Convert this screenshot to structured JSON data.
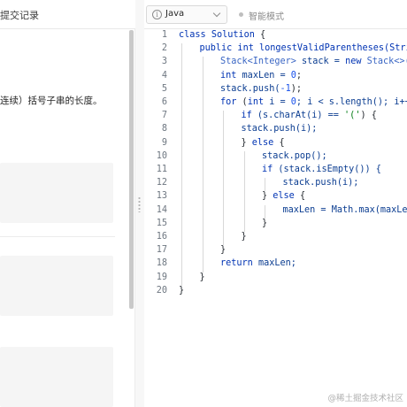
{
  "left_panel": {
    "tab_label": "提交记录",
    "description_fragment": "连续）括号子串的长度。"
  },
  "editor": {
    "language": "Java",
    "mode_label": "智能模式",
    "code_lines": [
      {
        "n": "1",
        "indent": 0,
        "tokens": [
          {
            "t": "class ",
            "c": "kw"
          },
          {
            "t": "Solution",
            "c": "cls"
          },
          {
            "t": " {",
            "c": "pl"
          }
        ]
      },
      {
        "n": "2",
        "indent": 1,
        "tokens": [
          {
            "t": "public int ",
            "c": "kw"
          },
          {
            "t": "longestValidParentheses(String s) {",
            "c": "cls"
          }
        ]
      },
      {
        "n": "3",
        "indent": 2,
        "tokens": [
          {
            "t": "Stack<Integer>",
            "c": "typ"
          },
          {
            "t": " stack = ",
            "c": "id"
          },
          {
            "t": "new ",
            "c": "kw"
          },
          {
            "t": "Stack<>();",
            "c": "typ"
          }
        ]
      },
      {
        "n": "4",
        "indent": 2,
        "tokens": [
          {
            "t": "int ",
            "c": "kw"
          },
          {
            "t": "maxLen = ",
            "c": "id"
          },
          {
            "t": "0",
            "c": "num"
          },
          {
            "t": ";",
            "c": "pl"
          }
        ]
      },
      {
        "n": "5",
        "indent": 2,
        "tokens": [
          {
            "t": "stack.push(",
            "c": "id"
          },
          {
            "t": "-1",
            "c": "num"
          },
          {
            "t": ");",
            "c": "pl"
          }
        ]
      },
      {
        "n": "6",
        "indent": 2,
        "tokens": [
          {
            "t": "for ",
            "c": "kw"
          },
          {
            "t": "(",
            "c": "pl"
          },
          {
            "t": "int ",
            "c": "kw"
          },
          {
            "t": "i = ",
            "c": "id"
          },
          {
            "t": "0",
            "c": "num"
          },
          {
            "t": "; i < s.length(); i++) {",
            "c": "id"
          }
        ]
      },
      {
        "n": "7",
        "indent": 3,
        "tokens": [
          {
            "t": "if ",
            "c": "kw"
          },
          {
            "t": "(s.charAt(i) == ",
            "c": "id"
          },
          {
            "t": "'('",
            "c": "str"
          },
          {
            "t": ") {",
            "c": "pl"
          }
        ]
      },
      {
        "n": "8",
        "indent": 3,
        "tokens": [
          {
            "t": "stack.push(i);",
            "c": "id"
          }
        ]
      },
      {
        "n": "9",
        "indent": 3,
        "tokens": [
          {
            "t": "} ",
            "c": "pl"
          },
          {
            "t": "else ",
            "c": "kw"
          },
          {
            "t": "{",
            "c": "pl"
          }
        ]
      },
      {
        "n": "10",
        "indent": 4,
        "tokens": [
          {
            "t": "stack.pop();",
            "c": "id"
          }
        ]
      },
      {
        "n": "11",
        "indent": 4,
        "tokens": [
          {
            "t": "if ",
            "c": "kw"
          },
          {
            "t": "(stack.isEmpty()) {",
            "c": "id"
          }
        ]
      },
      {
        "n": "12",
        "indent": 5,
        "tokens": [
          {
            "t": "stack.push(i);",
            "c": "id"
          }
        ]
      },
      {
        "n": "13",
        "indent": 4,
        "tokens": [
          {
            "t": "} ",
            "c": "pl"
          },
          {
            "t": "else ",
            "c": "kw"
          },
          {
            "t": "{",
            "c": "pl"
          }
        ]
      },
      {
        "n": "14",
        "indent": 5,
        "tokens": [
          {
            "t": "maxLen = Math.max(maxLen, i - stack.peek());",
            "c": "id"
          }
        ]
      },
      {
        "n": "15",
        "indent": 4,
        "tokens": [
          {
            "t": "}",
            "c": "pl"
          }
        ]
      },
      {
        "n": "16",
        "indent": 3,
        "tokens": [
          {
            "t": "}",
            "c": "pl"
          }
        ]
      },
      {
        "n": "17",
        "indent": 2,
        "tokens": [
          {
            "t": "}",
            "c": "pl"
          }
        ]
      },
      {
        "n": "18",
        "indent": 2,
        "tokens": [
          {
            "t": "return ",
            "c": "kw"
          },
          {
            "t": "maxLen;",
            "c": "id"
          }
        ]
      },
      {
        "n": "19",
        "indent": 1,
        "tokens": [
          {
            "t": "}",
            "c": "pl"
          }
        ]
      },
      {
        "n": "20",
        "indent": 0,
        "tokens": [
          {
            "t": "}",
            "c": "pl"
          }
        ]
      }
    ]
  },
  "watermark": "@稀土掘金技术社区",
  "icons": {
    "info": "info-icon",
    "language_dropdown": "chevron-down-icon",
    "mode_indicator": "status-dot-icon",
    "splitter": "drag-handle-icon"
  },
  "colors": {
    "keyword": "#0033b3",
    "number": "#1750eb",
    "string": "#067d17",
    "line_number": "#6e7781"
  }
}
